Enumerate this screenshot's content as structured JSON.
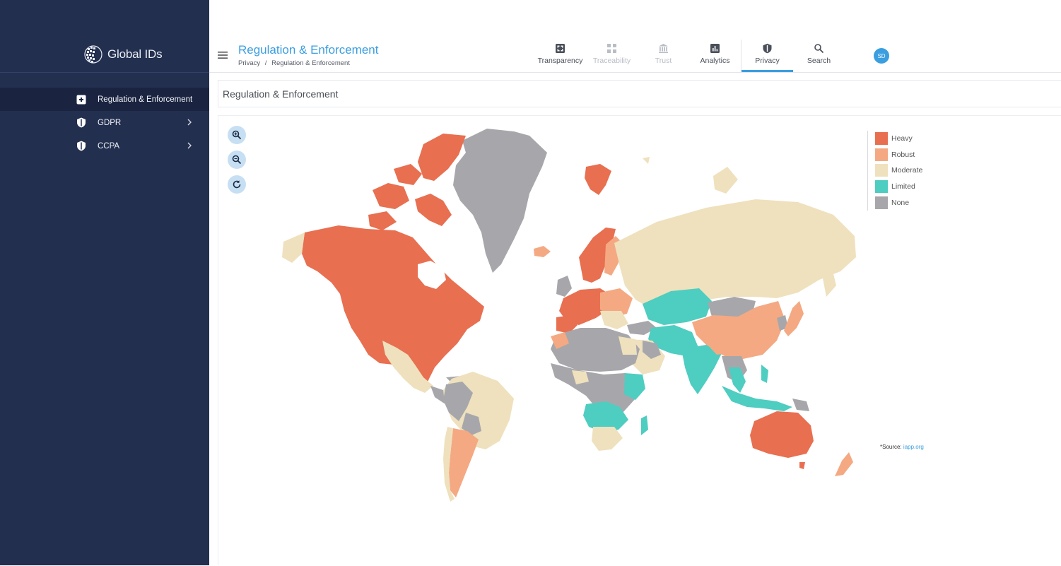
{
  "app": {
    "logo_text": "Global IDs"
  },
  "sidebar": {
    "items": [
      {
        "label": "Regulation & Enforcement",
        "icon": "transparency-icon",
        "active": true
      },
      {
        "label": "GDPR",
        "icon": "shield-icon",
        "has_children": true
      },
      {
        "label": "CCPA",
        "icon": "shield-icon",
        "has_children": true
      }
    ]
  },
  "header": {
    "title": "Regulation & Enforcement",
    "breadcrumb": [
      "Privacy",
      "/",
      "Regulation & Enforcement"
    ],
    "tabs": [
      {
        "label": "Transparency",
        "icon": "transparency-icon",
        "state": "normal"
      },
      {
        "label": "Traceability",
        "icon": "traceability-icon",
        "state": "disabled"
      },
      {
        "label": "Trust",
        "icon": "bank-icon",
        "state": "disabled"
      },
      {
        "label": "Analytics",
        "icon": "bar-chart-icon",
        "state": "normal"
      },
      {
        "label": "Privacy",
        "icon": "shield-icon",
        "state": "active"
      },
      {
        "label": "Search",
        "icon": "search-icon",
        "state": "normal"
      }
    ],
    "user_initials": "SD"
  },
  "section": {
    "title": "Regulation & Enforcement"
  },
  "map": {
    "legend": [
      {
        "label": "Heavy",
        "color": "#e86f50"
      },
      {
        "label": "Robust",
        "color": "#f4a982"
      },
      {
        "label": "Moderate",
        "color": "#efe1bd"
      },
      {
        "label": "Limited",
        "color": "#4ecdc1"
      },
      {
        "label": "None",
        "color": "#a7a7ab"
      }
    ],
    "source_prefix": "*Source:",
    "source_link": "iapp.org"
  }
}
